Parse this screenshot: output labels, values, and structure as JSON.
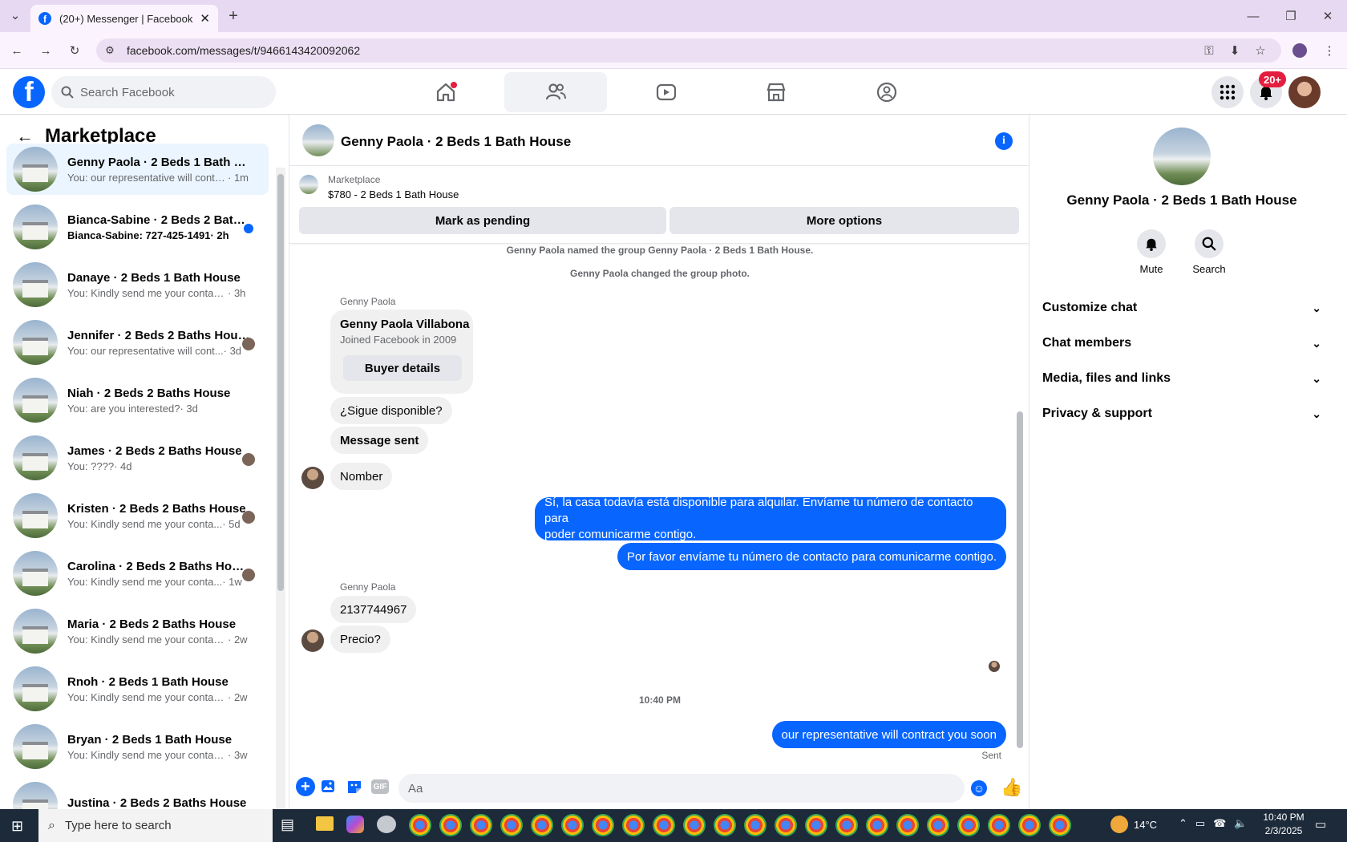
{
  "browser": {
    "tab_title": "(20+) Messenger | Facebook",
    "url": "facebook.com/messages/t/9466143420092062"
  },
  "fb": {
    "search_placeholder": "Search Facebook",
    "notif_badge": "20+"
  },
  "left": {
    "title": "Marketplace",
    "conversations": [
      {
        "name": "Genny Paola · 2 Beds 1 Bath Ho...",
        "preview": "You: our representative will contra...",
        "time": " · 1m"
      },
      {
        "name": "Bianca-Sabine · 2 Beds 2 Bath...",
        "preview": "Bianca-Sabine: 727-425-1491",
        "time": " · 2h"
      },
      {
        "name": "Danaye · 2 Beds 1 Bath House",
        "preview": "You: Kindly send me your contact n...",
        "time": " · 3h"
      },
      {
        "name": "Jennifer · 2 Beds 2 Baths House",
        "preview": "You: our representative will cont...",
        "time": " · 3d"
      },
      {
        "name": "Niah · 2 Beds 2 Baths House",
        "preview": "You: are you interested?",
        "time": " · 3d"
      },
      {
        "name": "James · 2 Beds 2 Baths House",
        "preview": "You: ????",
        "time": " · 4d"
      },
      {
        "name": "Kristen · 2 Beds 2 Baths House",
        "preview": "You: Kindly send me your conta...",
        "time": " · 5d"
      },
      {
        "name": "Carolina · 2 Beds 2 Baths House",
        "preview": "You: Kindly send me your conta...",
        "time": " · 1w"
      },
      {
        "name": "Maria · 2 Beds 2 Baths House",
        "preview": "You: Kindly send me your contact ...",
        "time": " · 2w"
      },
      {
        "name": "Rnoh · 2 Beds 1 Bath House",
        "preview": "You: Kindly send me your contact ...",
        "time": " · 2w"
      },
      {
        "name": "Bryan · 2 Beds 1 Bath House",
        "preview": "You: Kindly send me your contact ...",
        "time": " · 3w"
      },
      {
        "name": "Justina · 2 Beds 2 Baths House",
        "preview": "",
        "time": ""
      }
    ]
  },
  "chat": {
    "title": "Genny Paola · 2 Beds 1 Bath House",
    "listing_label": "Marketplace",
    "listing_price": "$780 - 2 Beds 1 Bath House",
    "mark_pending": "Mark as pending",
    "more_options": "More options",
    "sys1": "Genny Paola named the group Genny Paola · 2 Beds 1 Bath House.",
    "sys2": "Genny Paola changed the group photo.",
    "sender1": "Genny Paola",
    "card_name": "Genny Paola Villabona",
    "card_joined": "Joined Facebook in 2009",
    "card_btn": "Buyer details",
    "msg1": "¿Sigue disponible?",
    "msg2": "Message sent",
    "msg3": "Nomber",
    "my1a": "Sí, la casa todavía está disponible para alquilar. Envíame tu número de contacto para",
    "my1b": "poder comunicarme contigo.",
    "my2": "Por favor envíame tu número de contacto para comunicarme contigo.",
    "sender2": "Genny Paola",
    "msg4": "2137744967",
    "msg5": "Precio?",
    "time": "10:40 PM",
    "my3": "our representative will contract you soon",
    "sent": "Sent",
    "composer_placeholder": "Aa",
    "gif": "GIF"
  },
  "right": {
    "name": "Genny Paola · 2 Beds 1 Bath House",
    "mute": "Mute",
    "search": "Search",
    "sections": [
      "Customize chat",
      "Chat members",
      "Media, files and links",
      "Privacy & support"
    ]
  },
  "taskbar": {
    "search_placeholder": "Type here to search",
    "temp": "14°C",
    "time": "10:40 PM",
    "date": "2/3/2025"
  },
  "colors": {
    "fb_blue": "#0866ff",
    "active_row": "#ebf5ff",
    "badge_red": "#e41e3f"
  }
}
